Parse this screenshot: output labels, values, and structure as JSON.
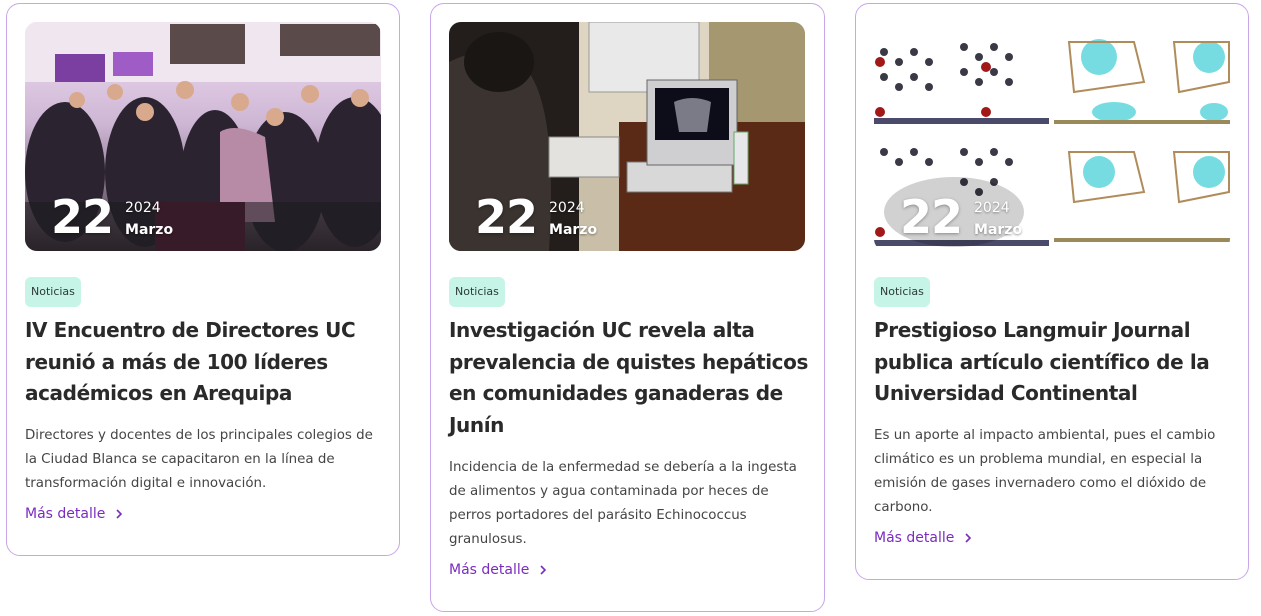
{
  "cards": [
    {
      "day": "22",
      "year": "2024",
      "month": "Marzo",
      "tag": "Noticias",
      "title": "IV Encuentro de Directores UC reunió a más de 100 líderes académicos en Arequipa",
      "excerpt": "Directores y docentes de los principales colegios de la Ciudad Blanca se capacitaron en la línea de transformación digital e innovación.",
      "more": "Más detalle",
      "image": "photo-auditorium-audience"
    },
    {
      "day": "22",
      "year": "2024",
      "month": "Marzo",
      "tag": "Noticias",
      "title": "Investigación UC revela alta prevalencia de quistes hepáticos en comunidades ganaderas de Junín",
      "excerpt": "Incidencia de la enfermedad se debería a la ingesta de alimentos y agua contaminada por heces de perros portadores del parásito Echinococcus granulosus.",
      "more": "Más detalle",
      "image": "photo-ultrasound-lab"
    },
    {
      "day": "22",
      "year": "2024",
      "month": "Marzo",
      "tag": "Noticias",
      "title": "Prestigioso Langmuir Journal publica artículo científico de la Universidad Continental",
      "excerpt": "Es un aporte al impacto ambiental, pues el cambio climático es un problema mundial, en especial la emisión de gases invernadero como el dióxido de carbono.",
      "more": "Más detalle",
      "image": "figure-molecular-structures"
    }
  ],
  "colors": {
    "accent": "#7b2cc0",
    "border": "#c9a6ea",
    "tag_bg": "#c6f5e8"
  }
}
